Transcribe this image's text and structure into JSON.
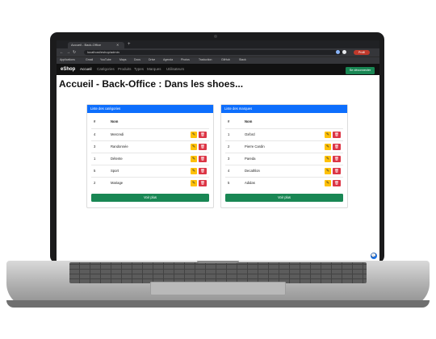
{
  "browser": {
    "tab_title": "Accueil - Back-Office",
    "tab_close_icon": "close-icon",
    "new_tab_symbol": "+",
    "url": "localhost/eshop/admin",
    "profile_label": "Profil",
    "bookmarks": [
      "Applications",
      "Gmail",
      "YouTube",
      "Maps",
      "Docs",
      "Drive",
      "Agenda",
      "Photos",
      "Traduction",
      "GitHub",
      "Stack"
    ]
  },
  "navbar": {
    "brand": "eShop",
    "links": [
      "Accueil",
      "Catégories",
      "Produits",
      "Types",
      "Marques",
      "Utilisateurs"
    ],
    "action_button": "Se déconnecter"
  },
  "page": {
    "title": "Accueil - Back-Office : Dans les shoes..."
  },
  "categories_card": {
    "header": "Liste des catégories",
    "col_id": "#",
    "col_name": "Nom",
    "rows": [
      {
        "id": "4",
        "name": "Mercredi"
      },
      {
        "id": "3",
        "name": "Randonnée"
      },
      {
        "id": "1",
        "name": "Détente"
      },
      {
        "id": "5",
        "name": "Sport"
      },
      {
        "id": "2",
        "name": "Mariage"
      }
    ],
    "edit_icon": "pencil-icon",
    "delete_icon": "trash-icon",
    "see_more": "Voir plus"
  },
  "brands_card": {
    "header": "Liste des marques",
    "col_id": "#",
    "col_name": "Nom",
    "rows": [
      {
        "id": "1",
        "name": "Oxford"
      },
      {
        "id": "2",
        "name": "Pierre Cardin"
      },
      {
        "id": "3",
        "name": "Pareda"
      },
      {
        "id": "4",
        "name": "Decathlon"
      },
      {
        "id": "5",
        "name": "Adidas"
      }
    ],
    "edit_icon": "pencil-icon",
    "delete_icon": "trash-icon",
    "see_more": "Voir plus"
  },
  "colors": {
    "primary": "#0d6efd",
    "success": "#198754",
    "warning": "#ffc107",
    "danger": "#dc3545",
    "navbar": "#111111"
  }
}
